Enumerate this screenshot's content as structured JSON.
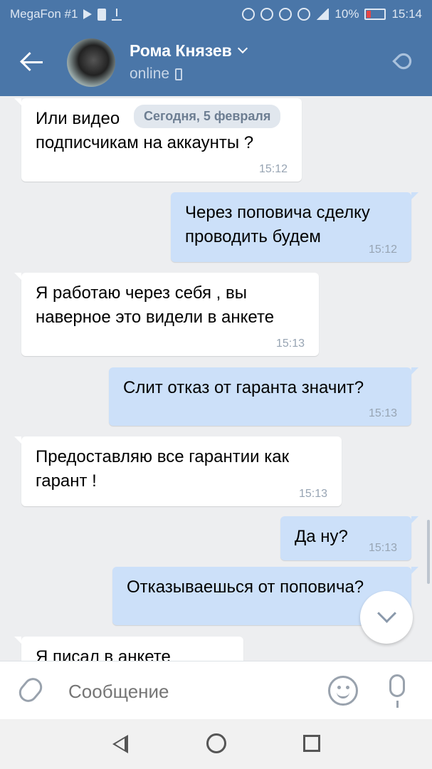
{
  "status_bar": {
    "carrier": "MegaFon #1",
    "battery": "10%",
    "time": "15:14"
  },
  "header": {
    "contact_name": "Рома Князев",
    "status": "online"
  },
  "chat": {
    "date_separator": "Сегодня, 5 февраля",
    "messages": [
      {
        "direction": "in",
        "text": "Или видео",
        "text2": "подписчикам на аккаунты ?",
        "time": "15:12"
      },
      {
        "direction": "out",
        "text": "Через поповича сделку",
        "text2": "проводить будем",
        "time": "15:12"
      },
      {
        "direction": "in",
        "text": "Я работаю через себя , вы",
        "text2": "наверное это видели в анкете",
        "time": "15:13"
      },
      {
        "direction": "out",
        "text": "Слит отказ от гаранта значит?",
        "time": "15:13"
      },
      {
        "direction": "in",
        "text": "Предоставляю все гарантии как",
        "text2": "гарант !",
        "time": "15:13"
      },
      {
        "direction": "out",
        "text": "Да ну?",
        "time": "15:13"
      },
      {
        "direction": "out",
        "text": "Отказываешься от поповича?"
      },
      {
        "direction": "in",
        "text": "Я писал в анкете"
      }
    ]
  },
  "input_bar": {
    "placeholder": "Сообщение"
  },
  "icons": {
    "accent": "#4a76a8",
    "outgoing_bubble": "#cce0f9"
  }
}
